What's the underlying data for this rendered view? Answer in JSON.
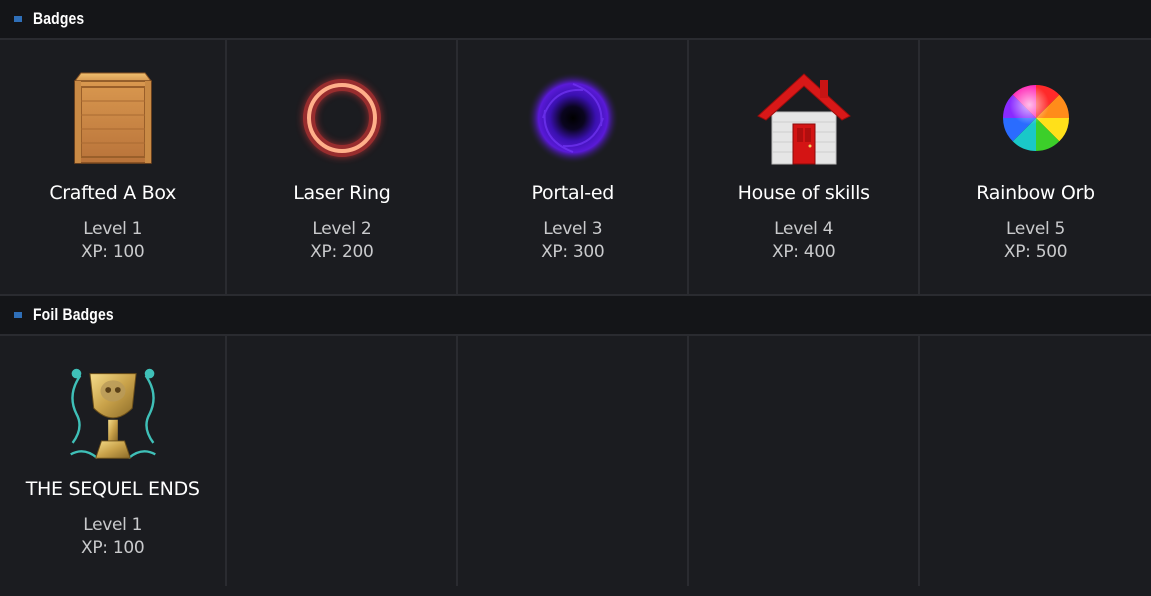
{
  "sections": {
    "badges": {
      "title": "Badges",
      "items": [
        {
          "name": "Crafted A Box",
          "level": "Level 1",
          "xp": "XP: 100",
          "icon": "crate-icon"
        },
        {
          "name": "Laser Ring",
          "level": "Level 2",
          "xp": "XP: 200",
          "icon": "laser-ring-icon"
        },
        {
          "name": "Portal-ed",
          "level": "Level 3",
          "xp": "XP: 300",
          "icon": "portal-icon"
        },
        {
          "name": "House of skills",
          "level": "Level 4",
          "xp": "XP: 400",
          "icon": "house-icon"
        },
        {
          "name": "Rainbow Orb",
          "level": "Level 5",
          "xp": "XP: 500",
          "icon": "rainbow-orb-icon"
        }
      ]
    },
    "foil": {
      "title": "Foil Badges",
      "items": [
        {
          "name": "THE SEQUEL ENDS",
          "level": "Level 1",
          "xp": "XP: 100",
          "icon": "trophy-icon"
        }
      ]
    }
  },
  "colors": {
    "background": "#1b1c20",
    "header_bg": "#141518",
    "accent": "#2f6fb8"
  }
}
